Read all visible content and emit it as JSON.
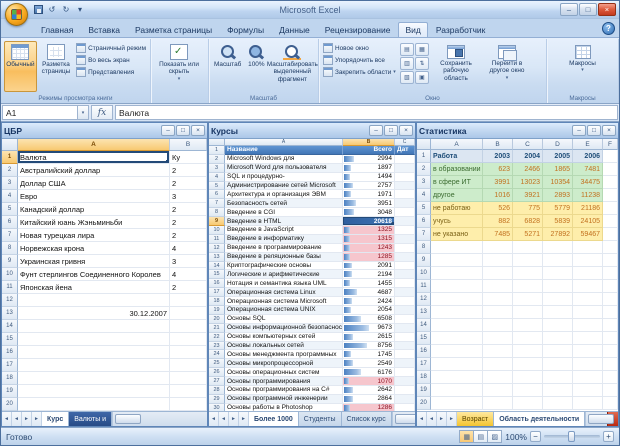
{
  "titlebar": {
    "title": "Microsoft Excel"
  },
  "ribbon": {
    "tabs": [
      "Главная",
      "Вставка",
      "Разметка страницы",
      "Формулы",
      "Данные",
      "Рецензирование",
      "Вид",
      "Разработчик"
    ],
    "active_tab": "Вид",
    "help": "?",
    "groups": {
      "views": {
        "label": "Режимы просмотра книги",
        "normal": "Обычный",
        "page_layout": "Разметка страницы",
        "page_break": "Страничный режим",
        "full_screen": "Во весь экран",
        "custom": "Представления"
      },
      "show_hide": {
        "button": "Показать или скрыть"
      },
      "zoom": {
        "label": "Масштаб",
        "zoom": "Масштаб",
        "hundred": "100%",
        "to_selection": "Масштабировать выделенный фрагмент"
      },
      "window": {
        "label": "Окно",
        "new_window": "Новое окно",
        "arrange": "Упорядочить все",
        "freeze": "Закрепить области",
        "save_workspace": "Сохранить рабочую область",
        "switch_window": "Перейти в другое окно"
      },
      "macros": {
        "label": "Макросы",
        "button": "Макросы"
      }
    }
  },
  "formula_bar": {
    "name_box": "A1",
    "fx": "fx",
    "value": "Валюта"
  },
  "windows": [
    {
      "title": "ЦБР",
      "letters": [
        "A",
        "B"
      ],
      "rows": [
        [
          "1",
          "Валюта",
          "Ку"
        ],
        [
          "2",
          "Австралийский доллар",
          "2"
        ],
        [
          "3",
          "Доллар США",
          "2"
        ],
        [
          "4",
          "Евро",
          "3"
        ],
        [
          "5",
          "Канадский доллар",
          "2"
        ],
        [
          "6",
          "Китайский юань Жэньминьби",
          "2"
        ],
        [
          "7",
          "Новая турецкая лира",
          "2"
        ],
        [
          "8",
          "Норвежская крона",
          "4"
        ],
        [
          "9",
          "Украинская гривня",
          "3"
        ],
        [
          "10",
          "Фунт стерлингов Соединенного Королев",
          "4"
        ],
        [
          "11",
          "Японская йена",
          "2"
        ],
        [
          "12",
          "",
          ""
        ],
        [
          "13",
          "30.12.2007",
          ""
        ]
      ],
      "empty_rows": [
        "14",
        "15",
        "16",
        "17",
        "18",
        "19",
        "20"
      ],
      "selected_cell": "A1",
      "tabs": [
        {
          "label": "Курс",
          "style": "active"
        },
        {
          "label": "Валюты и",
          "style": "dark"
        }
      ]
    },
    {
      "title": "Курсы",
      "letters": [
        "A",
        "B",
        "C"
      ],
      "header": {
        "n": "1",
        "name": "Название",
        "total": "Всего",
        "date": "Дат"
      },
      "rows": [
        {
          "n": "2",
          "name": "Microsoft Windows для",
          "value": 2994
        },
        {
          "n": "3",
          "name": "Microsoft Word для пользователя",
          "value": 1897
        },
        {
          "n": "4",
          "name": "SQL и процедурно-",
          "value": 1494
        },
        {
          "n": "5",
          "name": "Администрирование сетей Microsoft",
          "value": 2757
        },
        {
          "n": "6",
          "name": "Архитектура и организация ЭВМ",
          "value": 1971
        },
        {
          "n": "7",
          "name": "Безопасность сетей",
          "value": 3951
        },
        {
          "n": "8",
          "name": "Введение в CGI",
          "value": 3048
        },
        {
          "n": "9",
          "name": "Введение в HTML",
          "value": 20618,
          "selected": true
        },
        {
          "n": "10",
          "name": "Введение в JavaScript",
          "value": 1325,
          "pink": true
        },
        {
          "n": "11",
          "name": "Введение в информатику",
          "value": 1315,
          "pink": true
        },
        {
          "n": "12",
          "name": "Введение в программирование",
          "value": 1243,
          "pink": true
        },
        {
          "n": "13",
          "name": "Введение в реляционные базы",
          "value": 1285,
          "pink": true
        },
        {
          "n": "14",
          "name": "Криптографические основы",
          "value": 2091
        },
        {
          "n": "15",
          "name": "Логические и арифметические",
          "value": 2194
        },
        {
          "n": "16",
          "name": "Нотация и семантика языка UML",
          "value": 1455
        },
        {
          "n": "17",
          "name": "Операционная система Linux",
          "value": 4687
        },
        {
          "n": "18",
          "name": "Операционная система Microsoft",
          "value": 2424
        },
        {
          "n": "19",
          "name": "Операционная система UNIX",
          "value": 2054
        },
        {
          "n": "20",
          "name": "Основы SQL",
          "value": 6508
        },
        {
          "n": "21",
          "name": "Основы информационной безопасности",
          "value": 9673
        },
        {
          "n": "22",
          "name": "Основы компьютерных сетей",
          "value": 2615
        },
        {
          "n": "23",
          "name": "Основы локальных сетей",
          "value": 8756
        },
        {
          "n": "24",
          "name": "Основы менеджмента программных",
          "value": 1745
        },
        {
          "n": "25",
          "name": "Основы микропроцессорной",
          "value": 2549
        },
        {
          "n": "26",
          "name": "Основы операционных систем",
          "value": 6176
        },
        {
          "n": "27",
          "name": "Основы программирования",
          "value": 1070,
          "pink": true
        },
        {
          "n": "28",
          "name": "Основы программирования на C#",
          "value": 2642
        },
        {
          "n": "29",
          "name": "Основы программной инженерии",
          "value": 2864
        },
        {
          "n": "30",
          "name": "Основы работы в Photoshop",
          "value": 1286,
          "pink": true
        }
      ],
      "tabs": [
        {
          "label": "Более 1000",
          "style": "active"
        },
        {
          "label": "Студенты",
          "style": "normal"
        },
        {
          "label": "Список курс",
          "style": "normal"
        }
      ]
    },
    {
      "title": "Статистика",
      "letters": [
        "A",
        "B",
        "C",
        "D",
        "E",
        "F"
      ],
      "header": {
        "n": "1",
        "label": "Работа",
        "years": [
          "2003",
          "2004",
          "2005",
          "2006"
        ]
      },
      "rows": [
        {
          "n": "2",
          "label": "в образовании",
          "values": [
            "623",
            "2466",
            "1865",
            "7481"
          ],
          "style": "green"
        },
        {
          "n": "3",
          "label": "в сфере ИТ",
          "values": [
            "3991",
            "13023",
            "10354",
            "34475"
          ],
          "style": "green"
        },
        {
          "n": "4",
          "label": "другое",
          "values": [
            "1016",
            "3921",
            "2893",
            "11238"
          ],
          "style": "green"
        },
        {
          "n": "5",
          "label": "не работаю",
          "values": [
            "526",
            "775",
            "5779",
            "21186"
          ],
          "style": "yellow"
        },
        {
          "n": "6",
          "label": "учусь",
          "values": [
            "882",
            "6828",
            "5839",
            "24105"
          ],
          "style": "yellow"
        },
        {
          "n": "7",
          "label": "не указано",
          "values": [
            "7485",
            "5271",
            "27892",
            "59467"
          ],
          "style": "yellow"
        }
      ],
      "empty_rows": [
        "8",
        "9",
        "10",
        "11",
        "12",
        "13",
        "14",
        "15",
        "16",
        "17",
        "18",
        "19",
        "20"
      ],
      "tabs": [
        {
          "label": "Возраст",
          "style": "yellow"
        },
        {
          "label": "Область деятельности",
          "style": "active"
        }
      ]
    }
  ],
  "statusbar": {
    "mode": "Готово",
    "zoom": "100%"
  }
}
